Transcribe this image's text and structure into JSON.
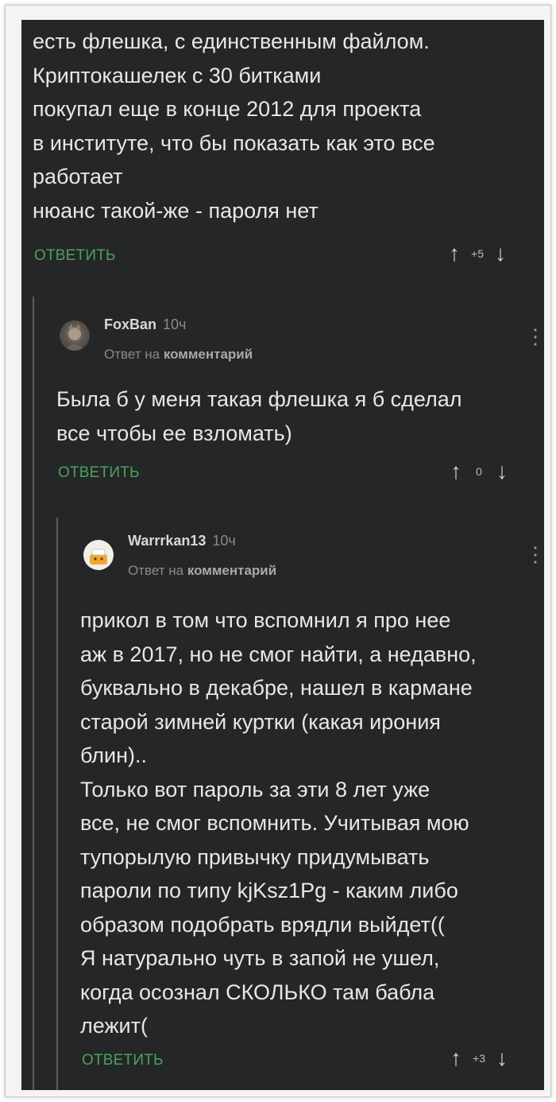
{
  "comment_top": {
    "lines": [
      "есть флешка, с единственным файлом.",
      "Криптокашелек с 30 битками",
      "покупал еще в конце 2012 для проекта",
      "в институте, что бы показать как это все",
      "работает",
      "нюанс такой-же - пароля нет"
    ],
    "reply_label": "ОТВЕТИТЬ",
    "score": "+5"
  },
  "comment_foxban": {
    "author": "FoxBan",
    "time": "10ч",
    "subtitle_prefix": "Ответ на",
    "subtitle_link": "комментарий",
    "lines": [
      "Была б у меня такая флешка я б сделал",
      "все чтобы ее взломать)"
    ],
    "reply_label": "ОТВЕТИТЬ",
    "score": "0"
  },
  "comment_warrrkan": {
    "author": "Warrrkan13",
    "time": "10ч",
    "subtitle_prefix": "Ответ на",
    "subtitle_link": "комментарий",
    "lines": [
      "прикол в том что вспомнил я про нее",
      "аж в 2017, но не смог найти, а недавно,",
      "буквально в декабре, нашел в кармане",
      "старой зимней куртки (какая ирония",
      "блин)..",
      "Только вот пароль за эти 8 лет уже",
      "все, не смог вспомнить. Учитывая мою",
      "тупорылую привычку придумывать",
      "пароли по типу kjKsz1Pg - каким либо",
      "образом подобрать врядли выйдет((",
      "Я натурально чуть в запой не ушел,",
      "когда осознал СКОЛЬКО там бабла",
      "лежит("
    ],
    "reply_label": "ОТВЕТИТЬ",
    "score": "+3"
  },
  "icons": {
    "upvote": "↑",
    "downvote": "↓",
    "more": "⋮"
  },
  "colors": {
    "background": "#242628",
    "text": "#e7e7e7",
    "accent_green": "#4aa35a",
    "muted": "#8a8a8a"
  }
}
